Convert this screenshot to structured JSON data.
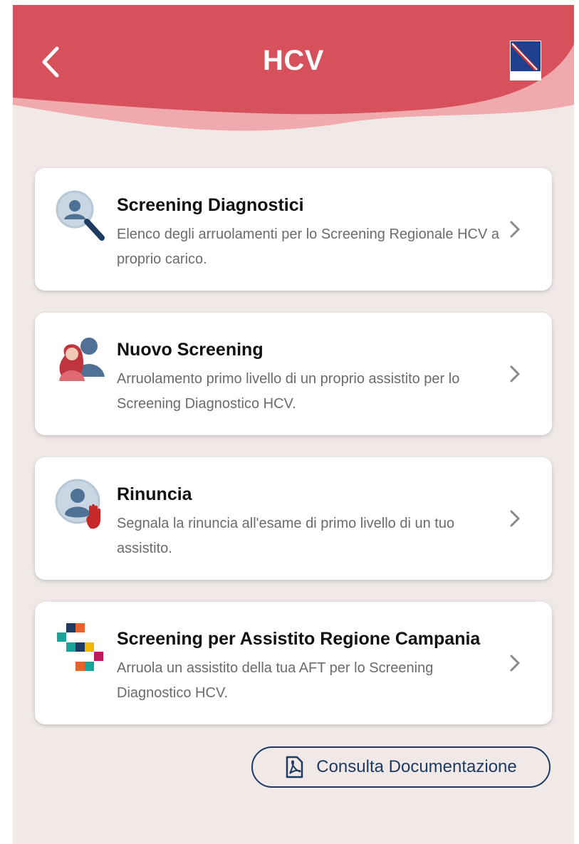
{
  "header": {
    "title": "HCV",
    "back_icon": "chevron-left-icon",
    "logo_text": "REGIONE CAMPANIA"
  },
  "colors": {
    "header_red": "#d6515c",
    "background": "#f0e9e7",
    "navy": "#1d3b63"
  },
  "cards": [
    {
      "title": "Screening Diagnostici",
      "description": "Elenco degli arruolamenti per lo Screening Regionale HCV a proprio carico.",
      "icon": "magnifier-user-icon"
    },
    {
      "title": "Nuovo Screening",
      "description": "Arruolamento primo livello di un proprio assistito per lo Screening Diagnostico HCV.",
      "icon": "people-icon"
    },
    {
      "title": "Rinuncia",
      "description": "Segnala la rinuncia all'esame di primo livello di un tuo assistito.",
      "icon": "user-stop-icon"
    },
    {
      "title": "Screening per Assistito Regione Campania",
      "description": "Arruola un assistito della tua AFT per lo Screening Diagnostico HCV.",
      "icon": "mosaic-logo-icon"
    }
  ],
  "doc_button": {
    "label": "Consulta Documentazione",
    "icon": "pdf-icon"
  }
}
